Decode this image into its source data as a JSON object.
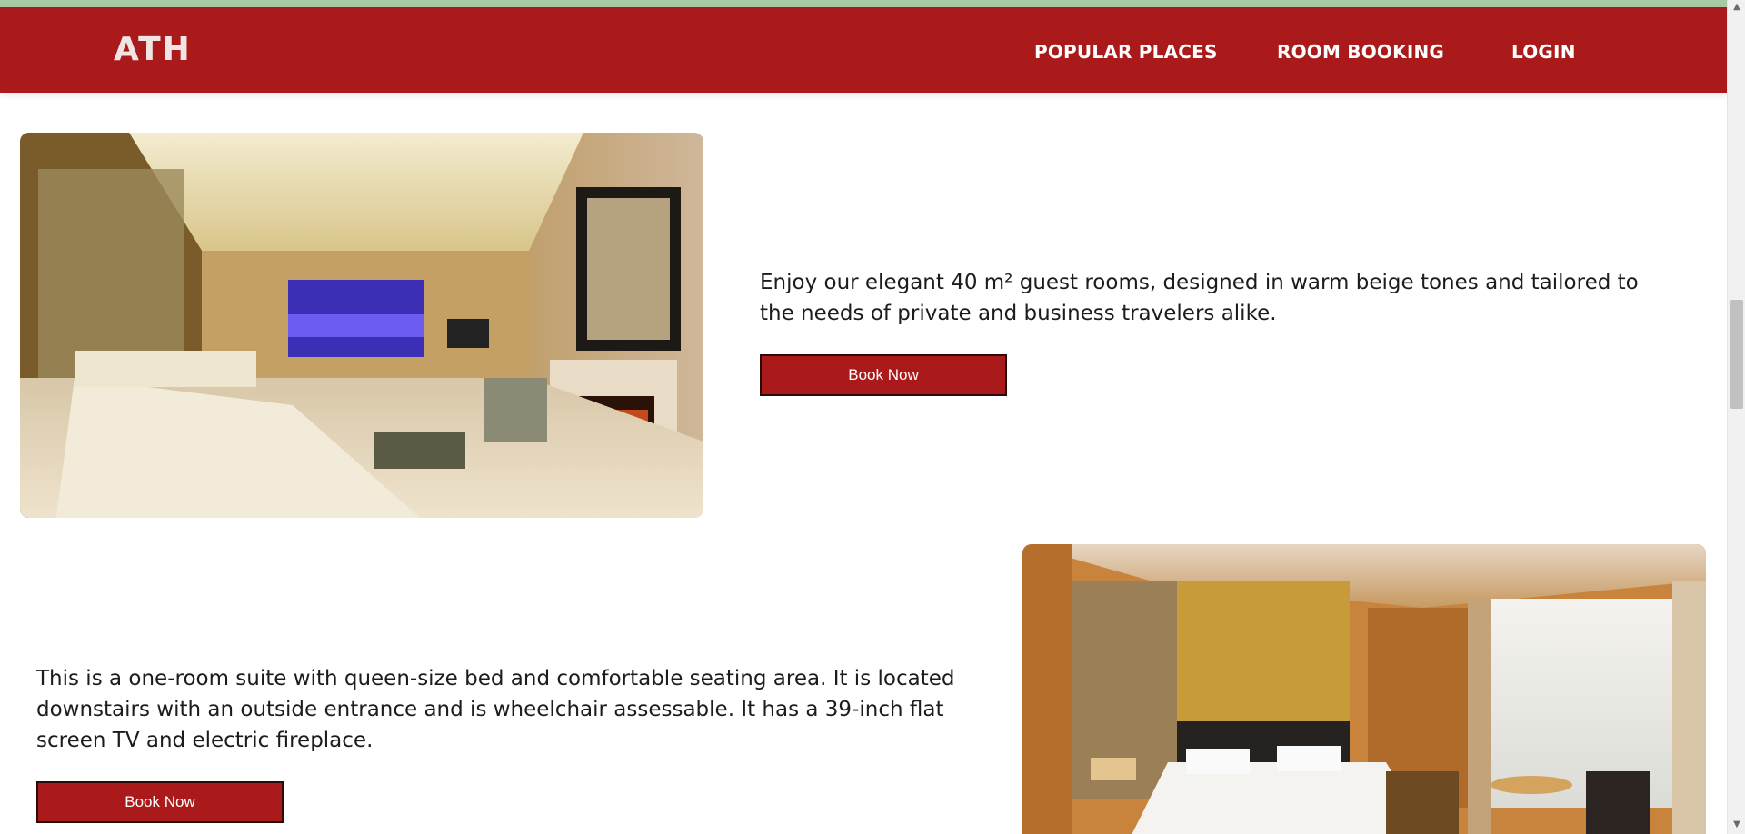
{
  "nav": {
    "brand": "ATH",
    "links": [
      "POPULAR PLACES",
      "ROOM BOOKING",
      "LOGIN"
    ]
  },
  "rooms": [
    {
      "description": "Enjoy our elegant 40 m² guest rooms, designed in warm beige tones and tailored to the needs of private and business travelers alike.",
      "button_label": "Book Now"
    },
    {
      "description": "This is a one-room suite with queen-size bed and comfortable seating area. It is located downstairs with an outside entrance and is wheelchair assessable. It has a 39-inch flat screen TV and electric fireplace.",
      "button_label": "Book Now"
    }
  ],
  "colors": {
    "brand_red": "#ab1a1b",
    "top_strip": "#a9c9a4"
  },
  "icons": {
    "scroll_up": "scroll-up-arrow-icon",
    "scroll_down": "scroll-down-arrow-icon"
  }
}
